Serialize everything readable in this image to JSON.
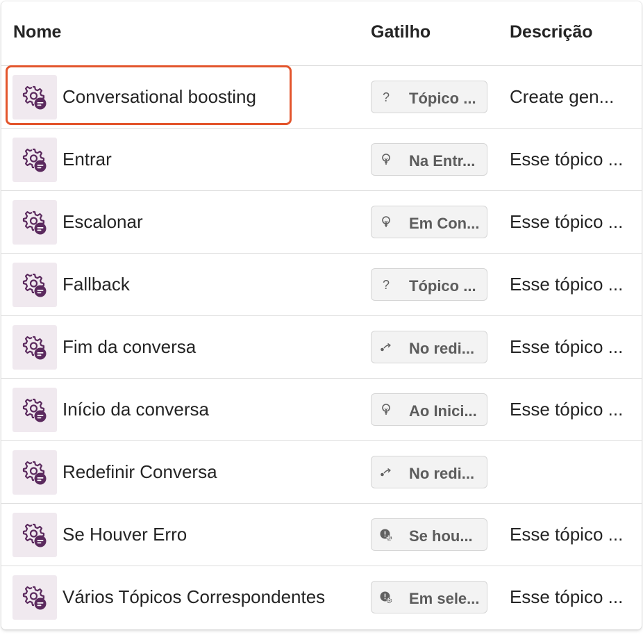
{
  "header": {
    "name": "Nome",
    "trigger": "Gatilho",
    "description": "Descrição"
  },
  "colors": {
    "icon_tile_bg": "#f0e9ef",
    "icon_color": "#5b2a5e",
    "highlight": "#e3552c"
  },
  "rows": [
    {
      "name": "Conversational boosting",
      "trigger_icon": "question-icon",
      "trigger": "Tópico ...",
      "description": "Create gen...",
      "highlighted": true
    },
    {
      "name": "Entrar",
      "trigger_icon": "lightbulb-icon",
      "trigger": "Na Entr...",
      "description": "Esse tópico ..."
    },
    {
      "name": "Escalonar",
      "trigger_icon": "lightbulb-icon",
      "trigger": "Em Con...",
      "description": "Esse tópico ..."
    },
    {
      "name": "Fallback",
      "trigger_icon": "question-icon",
      "trigger": "Tópico ...",
      "description": "Esse tópico ..."
    },
    {
      "name": "Fim da conversa",
      "trigger_icon": "redirect-icon",
      "trigger": "No redi...",
      "description": "Esse tópico ..."
    },
    {
      "name": "Início da conversa",
      "trigger_icon": "lightbulb-icon",
      "trigger": "Ao Inici...",
      "description": "Esse tópico ..."
    },
    {
      "name": "Redefinir Conversa",
      "trigger_icon": "redirect-icon",
      "trigger": "No redi...",
      "description": ""
    },
    {
      "name": "Se Houver Erro",
      "trigger_icon": "error-gear-icon",
      "trigger": "Se hou...",
      "description": "Esse tópico ..."
    },
    {
      "name": "Vários Tópicos Correspondentes",
      "trigger_icon": "error-gear-icon",
      "trigger": "Em sele...",
      "description": "Esse tópico ..."
    }
  ]
}
